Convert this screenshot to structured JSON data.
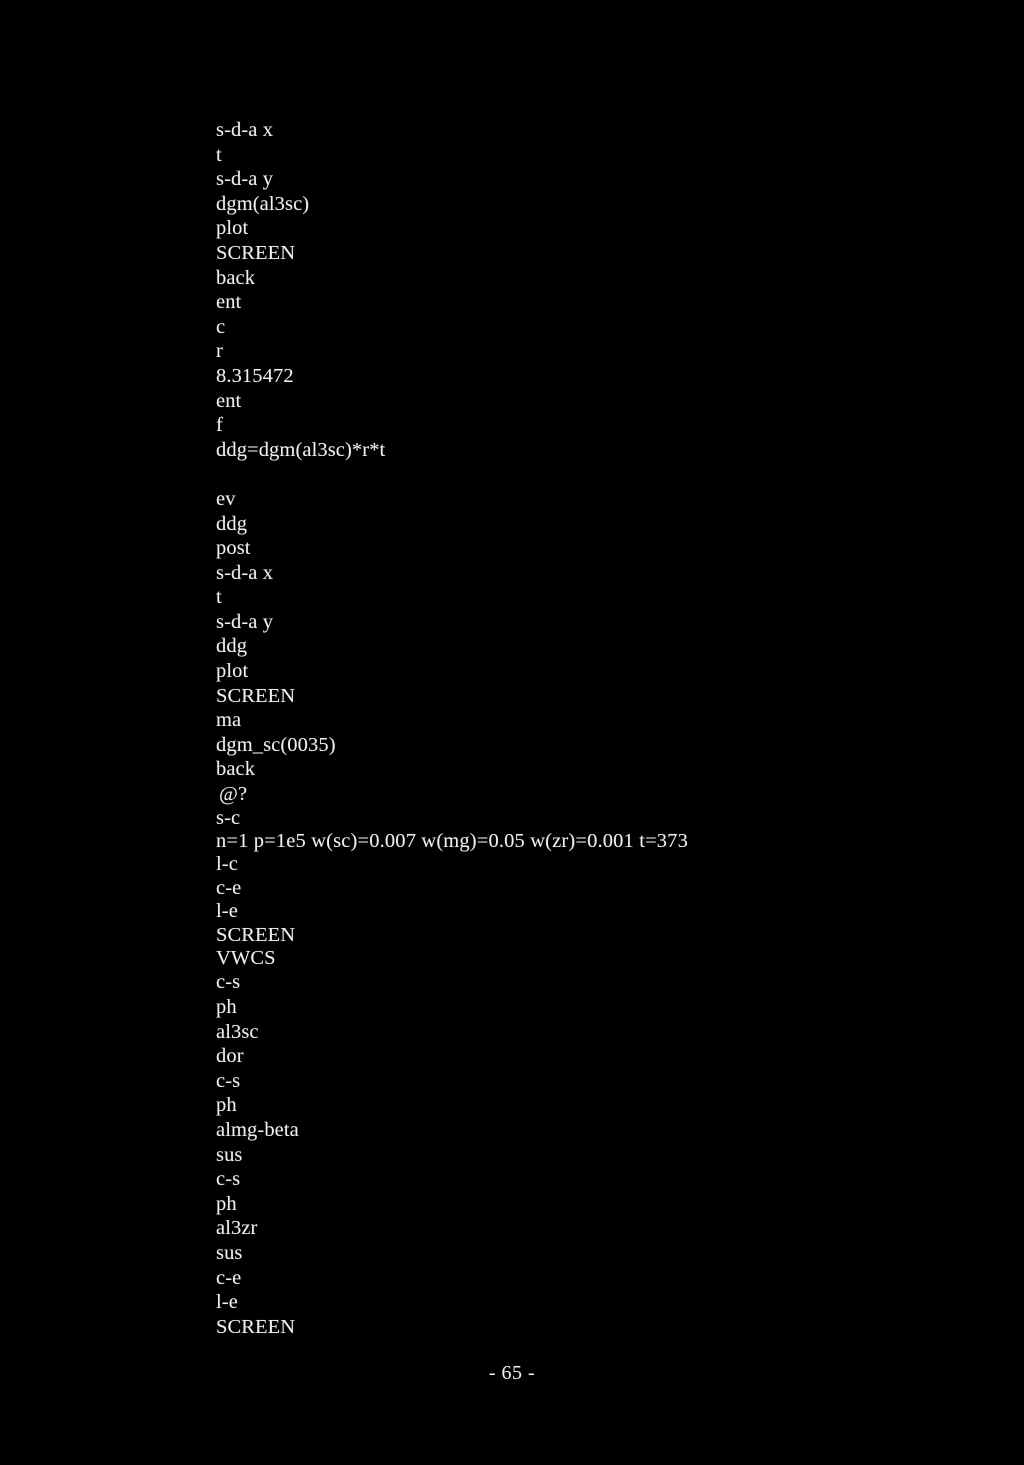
{
  "page": {
    "background_color": "#000000",
    "text_color": "#f0f0f0",
    "page_number": "- 65 -"
  },
  "script_listing": {
    "lines": [
      {
        "text": "s-d-a x"
      },
      {
        "text": "t"
      },
      {
        "text": "s-d-a y"
      },
      {
        "text": "dgm(al3sc)"
      },
      {
        "text": "plot"
      },
      {
        "text": "SCREEN"
      },
      {
        "text": "back"
      },
      {
        "text": "ent"
      },
      {
        "text": "c"
      },
      {
        "text": "r"
      },
      {
        "text": "8.315472"
      },
      {
        "text": "ent"
      },
      {
        "text": "f"
      },
      {
        "text": "ddg=dgm(al3sc)*r*t"
      },
      {
        "text": "",
        "style": "spacer"
      },
      {
        "text": "ev"
      },
      {
        "text": "ddg"
      },
      {
        "text": "post"
      },
      {
        "text": "s-d-a x"
      },
      {
        "text": "t"
      },
      {
        "text": "s-d-a y"
      },
      {
        "text": "ddg"
      },
      {
        "text": "plot"
      },
      {
        "text": "SCREEN"
      },
      {
        "text": "ma"
      },
      {
        "text": "dgm_sc(0035)"
      },
      {
        "text": "back"
      },
      {
        "text": "@?",
        "style": "indent"
      },
      {
        "text": "s-c",
        "style": "tight"
      },
      {
        "text": "n=1 p=1e5 w(sc)=0.007 w(mg)=0.05 w(zr)=0.001 t=373",
        "style": "params tight"
      },
      {
        "text": "l-c",
        "style": "tight"
      },
      {
        "text": "c-e",
        "style": "tight"
      },
      {
        "text": "l-e",
        "style": "tight"
      },
      {
        "text": "SCREEN",
        "style": "tight"
      },
      {
        "text": "VWCS",
        "style": "tight"
      },
      {
        "text": "c-s"
      },
      {
        "text": "ph"
      },
      {
        "text": "al3sc"
      },
      {
        "text": "dor"
      },
      {
        "text": "c-s"
      },
      {
        "text": "ph"
      },
      {
        "text": "almg-beta"
      },
      {
        "text": "sus"
      },
      {
        "text": "c-s"
      },
      {
        "text": "ph"
      },
      {
        "text": "al3zr"
      },
      {
        "text": "sus"
      },
      {
        "text": "c-e"
      },
      {
        "text": "l-e"
      },
      {
        "text": "SCREEN"
      }
    ]
  }
}
